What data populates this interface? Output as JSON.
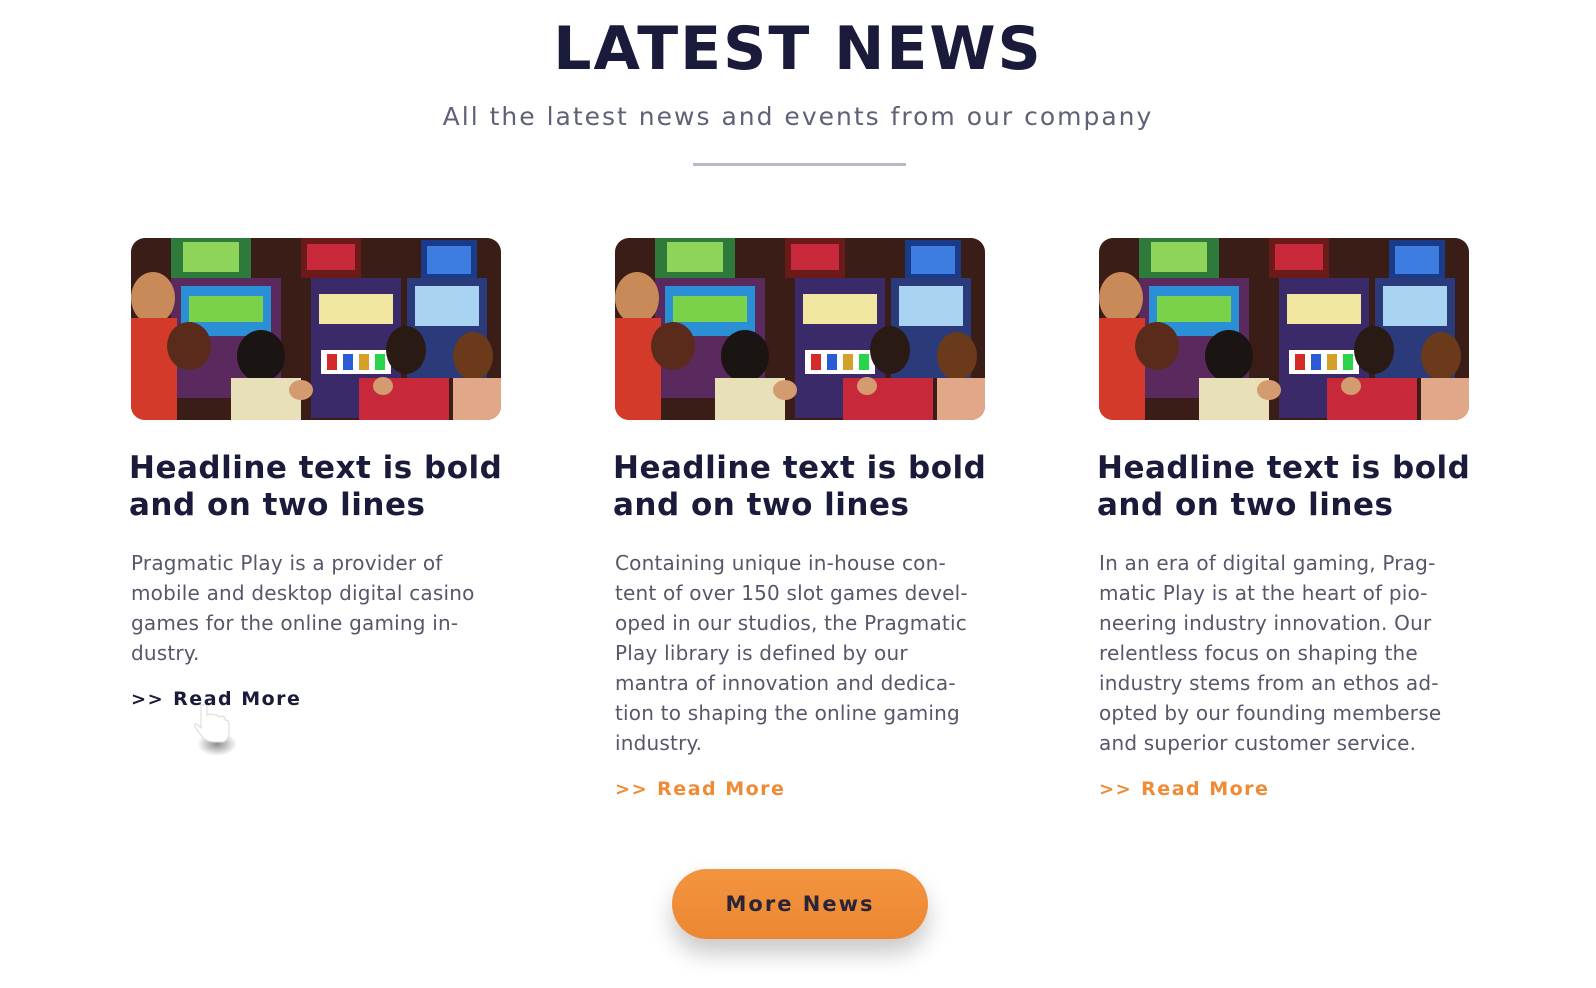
{
  "section": {
    "title": "LATEST NEWS",
    "subtitle": "All the latest news and events from our company"
  },
  "cards": [
    {
      "image": "casino-slot-players-photo",
      "headline": "Headline text is bold\nand on two lines",
      "body": "Pragmatic Play is a provider of\nmobile and desktop digital casino\ngames for the online gaming in-\ndustry.",
      "read_more": {
        "arrows": ">>",
        "label": "Read More",
        "color": "#1a1b3a"
      }
    },
    {
      "image": "casino-slot-players-photo",
      "headline": "Headline text is bold\nand on two lines",
      "body": "Containing unique in-house con-\ntent of over 150 slot games devel-\noped in our studios, the Pragmatic\nPlay library is defined by our\nmantra of innovation and dedica-\ntion to shaping the online gaming\nindustry.",
      "read_more": {
        "arrows": ">>",
        "label": "Read More",
        "color": "#ef8a35"
      }
    },
    {
      "image": "casino-slot-players-photo",
      "headline": "Headline text is bold\nand on two lines",
      "body": "In an era of digital gaming, Prag-\nmatic Play is at the heart of pio-\nneering industry innovation. Our\nrelentless focus on shaping the\nindustry stems from an ethos ad-\nopted by our founding memberse\nand superior customer service.",
      "read_more": {
        "arrows": ">>",
        "label": "Read More",
        "color": "#ef8a35"
      }
    }
  ],
  "more_news_button": {
    "label": "More News",
    "color": "#ef8a35"
  },
  "cursor": {
    "icon": "hand-pointer-icon"
  }
}
